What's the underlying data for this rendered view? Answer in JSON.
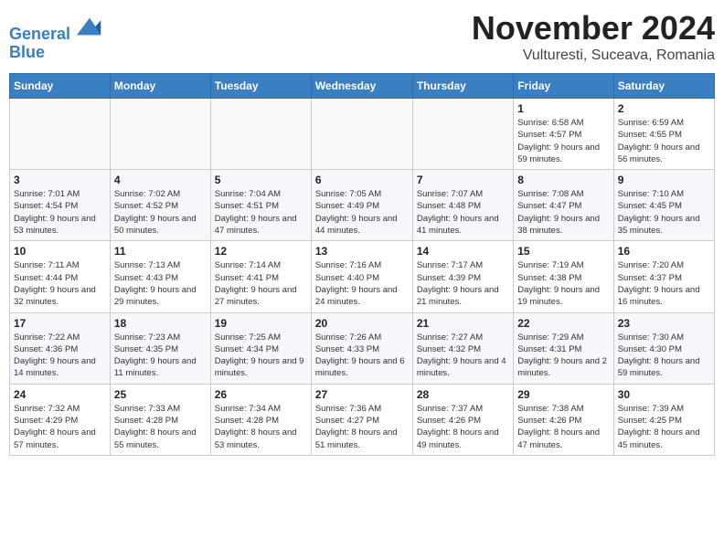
{
  "logo": {
    "line1": "General",
    "line2": "Blue"
  },
  "title": "November 2024",
  "subtitle": "Vulturesti, Suceava, Romania",
  "weekdays": [
    "Sunday",
    "Monday",
    "Tuesday",
    "Wednesday",
    "Thursday",
    "Friday",
    "Saturday"
  ],
  "weeks": [
    [
      {
        "day": "",
        "info": ""
      },
      {
        "day": "",
        "info": ""
      },
      {
        "day": "",
        "info": ""
      },
      {
        "day": "",
        "info": ""
      },
      {
        "day": "",
        "info": ""
      },
      {
        "day": "1",
        "info": "Sunrise: 6:58 AM\nSunset: 4:57 PM\nDaylight: 9 hours and 59 minutes."
      },
      {
        "day": "2",
        "info": "Sunrise: 6:59 AM\nSunset: 4:55 PM\nDaylight: 9 hours and 56 minutes."
      }
    ],
    [
      {
        "day": "3",
        "info": "Sunrise: 7:01 AM\nSunset: 4:54 PM\nDaylight: 9 hours and 53 minutes."
      },
      {
        "day": "4",
        "info": "Sunrise: 7:02 AM\nSunset: 4:52 PM\nDaylight: 9 hours and 50 minutes."
      },
      {
        "day": "5",
        "info": "Sunrise: 7:04 AM\nSunset: 4:51 PM\nDaylight: 9 hours and 47 minutes."
      },
      {
        "day": "6",
        "info": "Sunrise: 7:05 AM\nSunset: 4:49 PM\nDaylight: 9 hours and 44 minutes."
      },
      {
        "day": "7",
        "info": "Sunrise: 7:07 AM\nSunset: 4:48 PM\nDaylight: 9 hours and 41 minutes."
      },
      {
        "day": "8",
        "info": "Sunrise: 7:08 AM\nSunset: 4:47 PM\nDaylight: 9 hours and 38 minutes."
      },
      {
        "day": "9",
        "info": "Sunrise: 7:10 AM\nSunset: 4:45 PM\nDaylight: 9 hours and 35 minutes."
      }
    ],
    [
      {
        "day": "10",
        "info": "Sunrise: 7:11 AM\nSunset: 4:44 PM\nDaylight: 9 hours and 32 minutes."
      },
      {
        "day": "11",
        "info": "Sunrise: 7:13 AM\nSunset: 4:43 PM\nDaylight: 9 hours and 29 minutes."
      },
      {
        "day": "12",
        "info": "Sunrise: 7:14 AM\nSunset: 4:41 PM\nDaylight: 9 hours and 27 minutes."
      },
      {
        "day": "13",
        "info": "Sunrise: 7:16 AM\nSunset: 4:40 PM\nDaylight: 9 hours and 24 minutes."
      },
      {
        "day": "14",
        "info": "Sunrise: 7:17 AM\nSunset: 4:39 PM\nDaylight: 9 hours and 21 minutes."
      },
      {
        "day": "15",
        "info": "Sunrise: 7:19 AM\nSunset: 4:38 PM\nDaylight: 9 hours and 19 minutes."
      },
      {
        "day": "16",
        "info": "Sunrise: 7:20 AM\nSunset: 4:37 PM\nDaylight: 9 hours and 16 minutes."
      }
    ],
    [
      {
        "day": "17",
        "info": "Sunrise: 7:22 AM\nSunset: 4:36 PM\nDaylight: 9 hours and 14 minutes."
      },
      {
        "day": "18",
        "info": "Sunrise: 7:23 AM\nSunset: 4:35 PM\nDaylight: 9 hours and 11 minutes."
      },
      {
        "day": "19",
        "info": "Sunrise: 7:25 AM\nSunset: 4:34 PM\nDaylight: 9 hours and 9 minutes."
      },
      {
        "day": "20",
        "info": "Sunrise: 7:26 AM\nSunset: 4:33 PM\nDaylight: 9 hours and 6 minutes."
      },
      {
        "day": "21",
        "info": "Sunrise: 7:27 AM\nSunset: 4:32 PM\nDaylight: 9 hours and 4 minutes."
      },
      {
        "day": "22",
        "info": "Sunrise: 7:29 AM\nSunset: 4:31 PM\nDaylight: 9 hours and 2 minutes."
      },
      {
        "day": "23",
        "info": "Sunrise: 7:30 AM\nSunset: 4:30 PM\nDaylight: 8 hours and 59 minutes."
      }
    ],
    [
      {
        "day": "24",
        "info": "Sunrise: 7:32 AM\nSunset: 4:29 PM\nDaylight: 8 hours and 57 minutes."
      },
      {
        "day": "25",
        "info": "Sunrise: 7:33 AM\nSunset: 4:28 PM\nDaylight: 8 hours and 55 minutes."
      },
      {
        "day": "26",
        "info": "Sunrise: 7:34 AM\nSunset: 4:28 PM\nDaylight: 8 hours and 53 minutes."
      },
      {
        "day": "27",
        "info": "Sunrise: 7:36 AM\nSunset: 4:27 PM\nDaylight: 8 hours and 51 minutes."
      },
      {
        "day": "28",
        "info": "Sunrise: 7:37 AM\nSunset: 4:26 PM\nDaylight: 8 hours and 49 minutes."
      },
      {
        "day": "29",
        "info": "Sunrise: 7:38 AM\nSunset: 4:26 PM\nDaylight: 8 hours and 47 minutes."
      },
      {
        "day": "30",
        "info": "Sunrise: 7:39 AM\nSunset: 4:25 PM\nDaylight: 8 hours and 45 minutes."
      }
    ]
  ]
}
